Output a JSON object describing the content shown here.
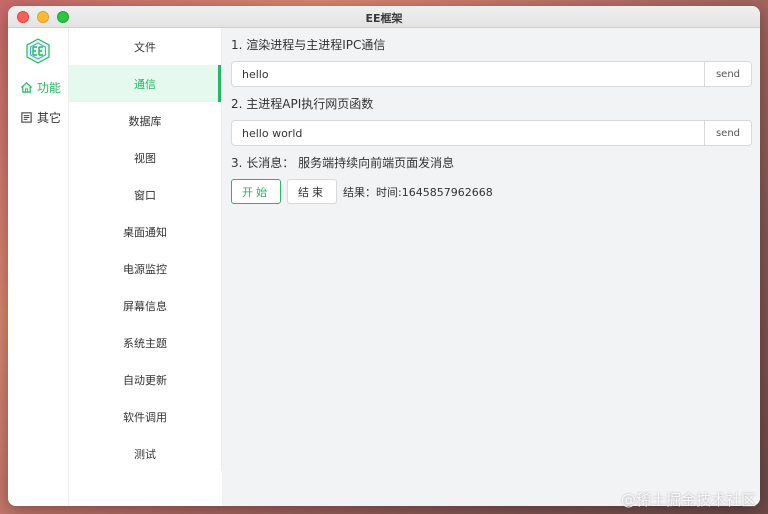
{
  "window": {
    "title": "EE框架"
  },
  "rail": {
    "items": [
      {
        "label": "功能",
        "icon": "home-icon",
        "active": true
      },
      {
        "label": "其它",
        "icon": "list-icon",
        "active": false
      }
    ]
  },
  "submenu": {
    "items": [
      {
        "label": "文件"
      },
      {
        "label": "通信",
        "active": true
      },
      {
        "label": "数据库"
      },
      {
        "label": "视图"
      },
      {
        "label": "窗口"
      },
      {
        "label": "桌面通知"
      },
      {
        "label": "电源监控"
      },
      {
        "label": "屏幕信息"
      },
      {
        "label": "系统主题"
      },
      {
        "label": "自动更新"
      },
      {
        "label": "软件调用"
      },
      {
        "label": "测试"
      }
    ]
  },
  "main": {
    "section1": {
      "title": "1. 渲染进程与主进程IPC通信",
      "input_value": "hello",
      "send_label": "send"
    },
    "section2": {
      "title": "2. 主进程API执行网页函数",
      "input_value": "hello world",
      "send_label": "send"
    },
    "section3": {
      "title": "3. 长消息：  服务端持续向前端页面发消息",
      "start_label": "开始",
      "stop_label": "结束",
      "result_text": "结果：时间:1645857962668"
    }
  },
  "watermark": "@稀土掘金技术社区",
  "colors": {
    "accent": "#27b566",
    "active_bg": "#e6f9ee"
  }
}
